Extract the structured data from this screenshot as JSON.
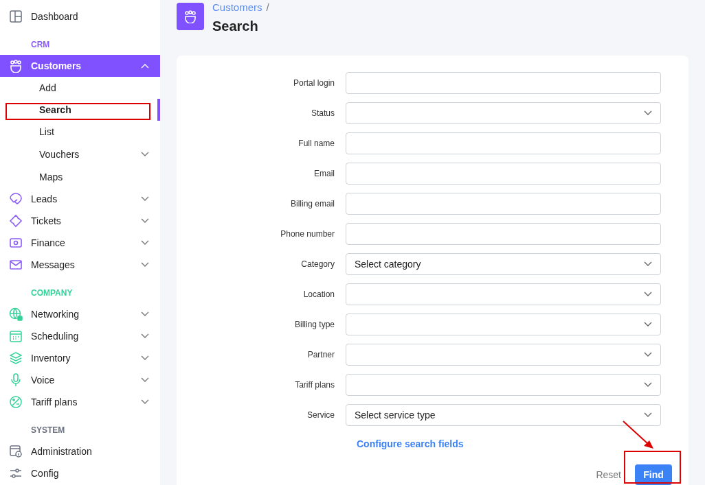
{
  "sidebar": {
    "sections": [
      {
        "items": [
          {
            "label": "Dashboard",
            "selected": false
          }
        ]
      },
      {
        "title": "CRM",
        "color": "#8b5cf6",
        "items": [
          {
            "label": "Customers",
            "expanded": true,
            "selected": true,
            "children": [
              {
                "label": "Add",
                "selected": false
              },
              {
                "label": "Search",
                "selected": true
              },
              {
                "label": "List",
                "selected": false
              },
              {
                "label": "Vouchers",
                "expanded": false,
                "selected": false
              },
              {
                "label": "Maps",
                "selected": false
              }
            ]
          },
          {
            "label": "Leads",
            "expanded": false,
            "selected": false
          },
          {
            "label": "Tickets",
            "expanded": false,
            "selected": false
          },
          {
            "label": "Finance",
            "expanded": false,
            "selected": false
          },
          {
            "label": "Messages",
            "expanded": false,
            "selected": false
          }
        ]
      },
      {
        "title": "COMPANY",
        "color": "#34d399",
        "items": [
          {
            "label": "Networking",
            "expanded": false,
            "selected": false
          },
          {
            "label": "Scheduling",
            "expanded": false,
            "selected": false
          },
          {
            "label": "Inventory",
            "expanded": false,
            "selected": false
          },
          {
            "label": "Voice",
            "expanded": false,
            "selected": false
          },
          {
            "label": "Tariff plans",
            "expanded": false,
            "selected": false
          }
        ]
      },
      {
        "title": "SYSTEM",
        "color": "#6b7280",
        "items": [
          {
            "label": "Administration",
            "selected": false
          },
          {
            "label": "Config",
            "selected": false
          }
        ]
      }
    ]
  },
  "header": {
    "breadcrumb": "Customers",
    "separator": "/",
    "title": "Search"
  },
  "form": {
    "fields": [
      {
        "label": "Portal login",
        "kind": "text"
      },
      {
        "label": "Status",
        "kind": "select"
      },
      {
        "label": "Full name",
        "kind": "text"
      },
      {
        "label": "Email",
        "kind": "text"
      },
      {
        "label": "Billing email",
        "kind": "text"
      },
      {
        "label": "Phone number",
        "kind": "text"
      },
      {
        "label": "Category",
        "kind": "select",
        "value": "Select category"
      },
      {
        "label": "Location",
        "kind": "select"
      },
      {
        "label": "Billing type",
        "kind": "select"
      },
      {
        "label": "Partner",
        "kind": "select"
      },
      {
        "label": "Tariff plans",
        "kind": "select"
      },
      {
        "label": "Service",
        "kind": "select",
        "value": "Select service type"
      }
    ],
    "configure_link": "Configure search fields",
    "reset_button": "Reset",
    "find_button": "Find"
  }
}
